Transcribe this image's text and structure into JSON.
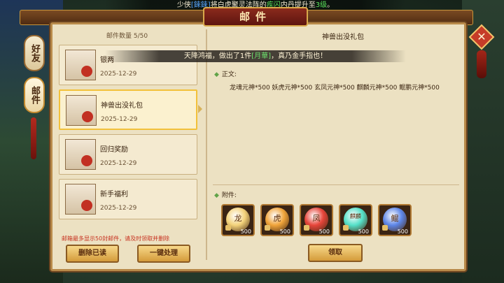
{
  "marquee": {
    "prefix": "少侠",
    "name": "[錸錸]",
    "mid": "将白虎聚灵法阵的",
    "skill": "疾闪",
    "suffix": "内丹提升至",
    "level": "3级",
    "end": "。"
  },
  "window": {
    "title": "邮件"
  },
  "side_tabs": [
    {
      "label": "好友"
    },
    {
      "label": "邮件"
    }
  ],
  "mail_list": {
    "count_label": "邮件数量 5/50",
    "items": [
      {
        "name": "银两",
        "date": "2025-12-29"
      },
      {
        "name": "神兽出没礼包",
        "date": "2025-12-29"
      },
      {
        "name": "回归奖励",
        "date": "2025-12-29"
      },
      {
        "name": "新手福利",
        "date": "2025-12-29"
      }
    ],
    "selected_index": 1,
    "notice": "邮箱最多显示50封邮件，请及时领取并删除",
    "delete_read_label": "删除已读",
    "one_click_label": "一键处理"
  },
  "toast": {
    "text1": "天降鸿福，做出了1件",
    "item": "[月華]",
    "text2": "，真乃金手指也！"
  },
  "detail": {
    "title": "神兽出没礼包",
    "body_label": "正文:",
    "body_text": "龙魂元神*500 妖虎元神*500 玄凤元神*500 麒麟元神*500 鲲鹏元神*500",
    "attach_label": "附件:",
    "attachments": [
      {
        "glyph": "龙",
        "qty": "500",
        "color": "#f3d27a"
      },
      {
        "glyph": "虎",
        "qty": "500",
        "color": "#f0a43a"
      },
      {
        "glyph": "凤",
        "qty": "500",
        "color": "#e6453a"
      },
      {
        "glyph": "麒麟",
        "qty": "500",
        "color": "#54e0c8"
      },
      {
        "glyph": "鲲",
        "qty": "500",
        "color": "#5d86e8"
      }
    ],
    "claim_label": "领取"
  },
  "icons": {
    "close": "close-icon",
    "mail": "mail-icon",
    "lock": "lock-icon"
  }
}
